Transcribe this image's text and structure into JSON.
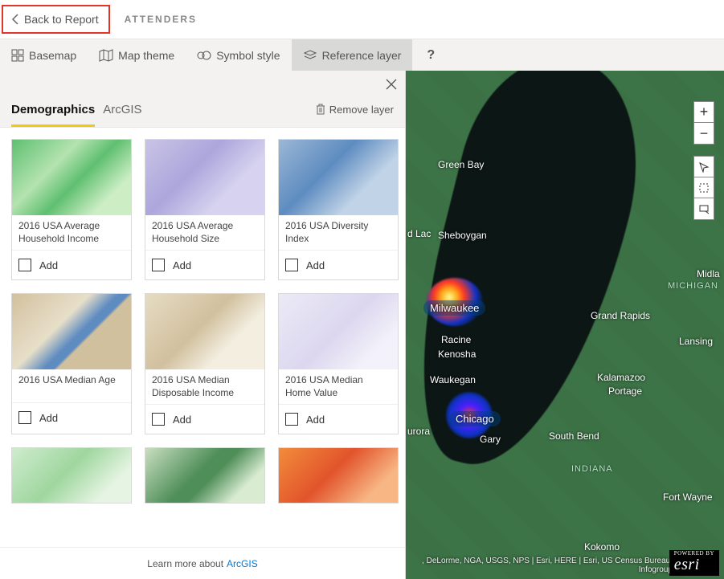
{
  "header": {
    "back_label": "Back to Report",
    "title": "ATTENDERS"
  },
  "toolbar": {
    "basemap": "Basemap",
    "map_theme": "Map theme",
    "symbol_style": "Symbol style",
    "reference_layer": "Reference layer",
    "help": "?"
  },
  "panel": {
    "tabs": {
      "demographics": "Demographics",
      "arcgis": "ArcGIS"
    },
    "remove_layer": "Remove layer",
    "add_label": "Add",
    "footer_prefix": "Learn more about ",
    "footer_link": "ArcGIS",
    "layers": [
      {
        "title": "2016 USA Average Household Income"
      },
      {
        "title": "2016 USA Average Household Size"
      },
      {
        "title": "2016 USA Diversity Index"
      },
      {
        "title": "2016 USA Median Age"
      },
      {
        "title": "2016 USA Median Disposable Income"
      },
      {
        "title": "2016 USA Median Home Value"
      }
    ]
  },
  "map": {
    "labels": {
      "green_bay": "Green Bay",
      "d_lac": "d Lac",
      "sheboygan": "Sheboygan",
      "milwaukee": "Milwaukee",
      "racine": "Racine",
      "kenosha": "Kenosha",
      "waukegan": "Waukegan",
      "chicago": "Chicago",
      "urora": "urora",
      "gary": "Gary",
      "grand_rapids": "Grand Rapids",
      "lansing": "Lansing",
      "kalamazoo": "Kalamazoo",
      "portage": "Portage",
      "south_bend": "South Bend",
      "fort_wayne": "Fort Wayne",
      "kokomo": "Kokomo",
      "mich": "MICHIGAN",
      "indiana": "INDIANA",
      "midla": "Midla"
    },
    "attribution": ", DeLorme, NGA, USGS, NPS | Esri, HERE | Esri, US Census Bureau, Infogroup",
    "esri_brand": "esri",
    "esri_powered": "POWERED BY"
  },
  "controls": {
    "zoom_in": "+",
    "zoom_out": "−"
  }
}
